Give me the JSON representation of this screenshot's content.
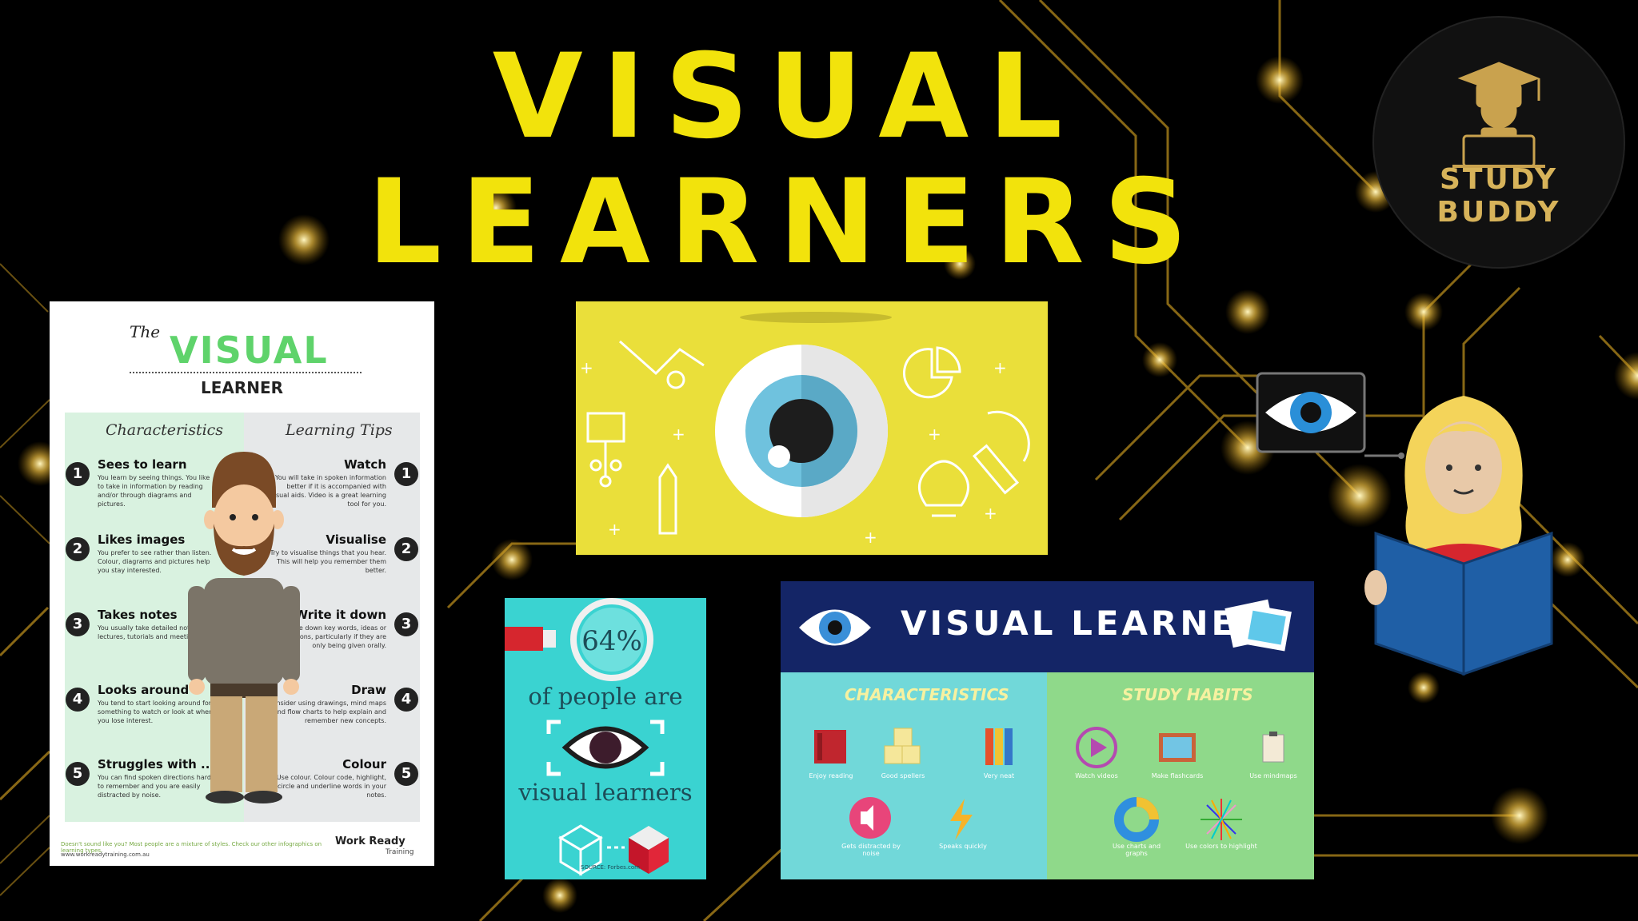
{
  "heading": {
    "line1": "VISUAL",
    "line2": "LEARNERS"
  },
  "badge": {
    "text": "STUDY BUDDY"
  },
  "poster": {
    "the": "The",
    "title": "VISUAL",
    "subtitle": "LEARNER",
    "col_left": "Characteristics",
    "col_right": "Learning Tips",
    "left_items": [
      {
        "n": "1",
        "title": "Sees to learn",
        "body": "You learn by seeing things. You like to take in information by reading and/or through diagrams and pictures."
      },
      {
        "n": "2",
        "title": "Likes images",
        "body": "You prefer to see rather than listen. Colour, diagrams and pictures help you stay interested."
      },
      {
        "n": "3",
        "title": "Takes notes",
        "body": "You usually take detailed notes in lectures, tutorials and meetings."
      },
      {
        "n": "4",
        "title": "Looks around",
        "body": "You tend to start looking around for something to watch or look at when you lose interest."
      },
      {
        "n": "5",
        "title": "Struggles with ...",
        "body": "You can find spoken directions hard to remember and you are easily distracted by noise."
      }
    ],
    "right_items": [
      {
        "n": "1",
        "title": "Watch",
        "body": "You will take in spoken information better if it is accompanied with visual aids. Video is a great learning tool for you."
      },
      {
        "n": "2",
        "title": "Visualise",
        "body": "Try to visualise things that you hear. This will help you remember them better."
      },
      {
        "n": "3",
        "title": "Write it down",
        "body": "Write down key words, ideas or instructions, particularly if they are only being given orally."
      },
      {
        "n": "4",
        "title": "Draw",
        "body": "Consider using drawings, mind maps and flow charts to help explain and remember new concepts."
      },
      {
        "n": "5",
        "title": "Colour",
        "body": "Use colour. Colour code, highlight, circle and underline words in your notes."
      }
    ],
    "footer": "Doesn't sound like you? Most people are a mixture of styles. Check our other infographics on learning types.",
    "url": "www.workreadytraining.com.au",
    "logo": "Work Ready",
    "logo_sub": "Training"
  },
  "stat_panel": {
    "percent": "64%",
    "line1": "of people are",
    "line2": "visual learners",
    "source": "SOURCE: Forbes.com"
  },
  "info_panel": {
    "title": "VISUAL LEARNERS",
    "characteristics": "CHARACTERISTICS",
    "study_habits": "STUDY HABITS",
    "char_labels": [
      "Enjoy reading",
      "Good spellers",
      "Very neat",
      "Gets distracted by noise",
      "Speaks quickly"
    ],
    "habit_labels": [
      "Watch videos",
      "Make flashcards",
      "Use mindmaps",
      "Use charts and graphs",
      "Use colors to highlight"
    ]
  },
  "colors": {
    "title_yellow": "#f2e30c",
    "poster_green": "#5fd36b",
    "panel_yellow": "#eadf3a",
    "panel_cyan": "#3ad3d1",
    "navy": "#142566"
  },
  "icons": [
    "graduate-laptop-icon",
    "eye-icon",
    "pie-chart-icon",
    "lightbulb-icon",
    "microscope-icon",
    "pencil-icon",
    "book-icon",
    "abc-blocks-icon",
    "pencils-icon",
    "speaker-icon",
    "lightning-icon",
    "play-icon",
    "picture-icon",
    "clipboard-icon",
    "donut-chart-icon",
    "color-wheel-icon",
    "photos-icon",
    "cube-icon"
  ]
}
